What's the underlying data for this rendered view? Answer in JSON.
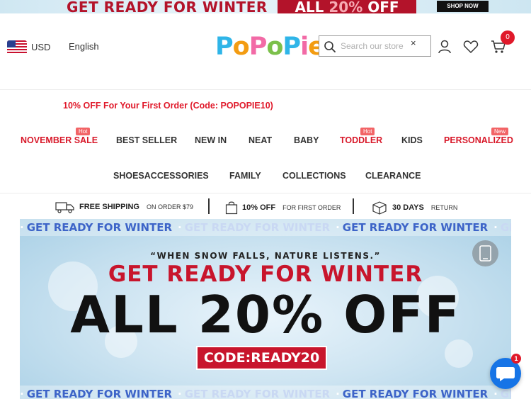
{
  "top_banner": {
    "headline": "GET READY FOR WINTER",
    "offer_prefix": "ALL ",
    "offer_pct": "20%",
    "offer_suffix": " OFF",
    "shop_button": "SHOP NOW"
  },
  "header": {
    "currency": "USD",
    "language": "English",
    "logo": "PoPoPie",
    "search_placeholder": "Search our store",
    "clear_symbol": "×",
    "cart_count": "0",
    "icons": [
      "flag-us-icon",
      "search-icon",
      "clear-icon",
      "account-icon",
      "wishlist-heart-icon",
      "cart-icon"
    ]
  },
  "announcement": "10% OFF For Your First Order (Code: POPOPIE10)",
  "nav": {
    "row1": [
      {
        "label": "NOVEMBER SALE",
        "badge": "Hot",
        "highlight": true
      },
      {
        "label": "BEST SELLER",
        "badge": "",
        "highlight": false
      },
      {
        "label": "NEW IN",
        "badge": "",
        "highlight": false
      },
      {
        "label": "NEAT",
        "badge": "",
        "highlight": false
      },
      {
        "label": "BABY",
        "badge": "",
        "highlight": false
      },
      {
        "label": "TODDLER",
        "badge": "Hot",
        "highlight": true
      },
      {
        "label": "KIDS",
        "badge": "",
        "highlight": false
      },
      {
        "label": "PERSONALIZED",
        "badge": "New",
        "highlight": true
      }
    ],
    "row2": [
      {
        "label": "SHOESACCESSORIES"
      },
      {
        "label": "FAMILY"
      },
      {
        "label": "COLLECTIONS"
      },
      {
        "label": "CLEARANCE"
      }
    ]
  },
  "shipping_bar": {
    "items": [
      {
        "strong": "FREE SHIPPING",
        "light": "ON ORDER $79",
        "icon": "truck-icon"
      },
      {
        "strong": "10% OFF",
        "light": "FOR FIRST ORDER",
        "icon": "shopping-bag-icon"
      },
      {
        "strong": "30 DAYS",
        "light": "RETURN",
        "icon": "return-box-icon"
      }
    ]
  },
  "hero": {
    "marquee_text": "GET READY FOR WINTER",
    "marquee_partial": "GET RE",
    "quote": "“WHEN SNOW FALLS, NATURE LISTENS.”",
    "title": "GET READY FOR WINTER",
    "offer": "ALL 20% OFF",
    "code": "CODE:READY20"
  },
  "chat": {
    "unread": "1"
  },
  "colors": {
    "brand_red": "#d8192a",
    "badge_pink": "#f26466",
    "marquee_blue": "#3d64c8",
    "chat_blue": "#1674e6"
  }
}
